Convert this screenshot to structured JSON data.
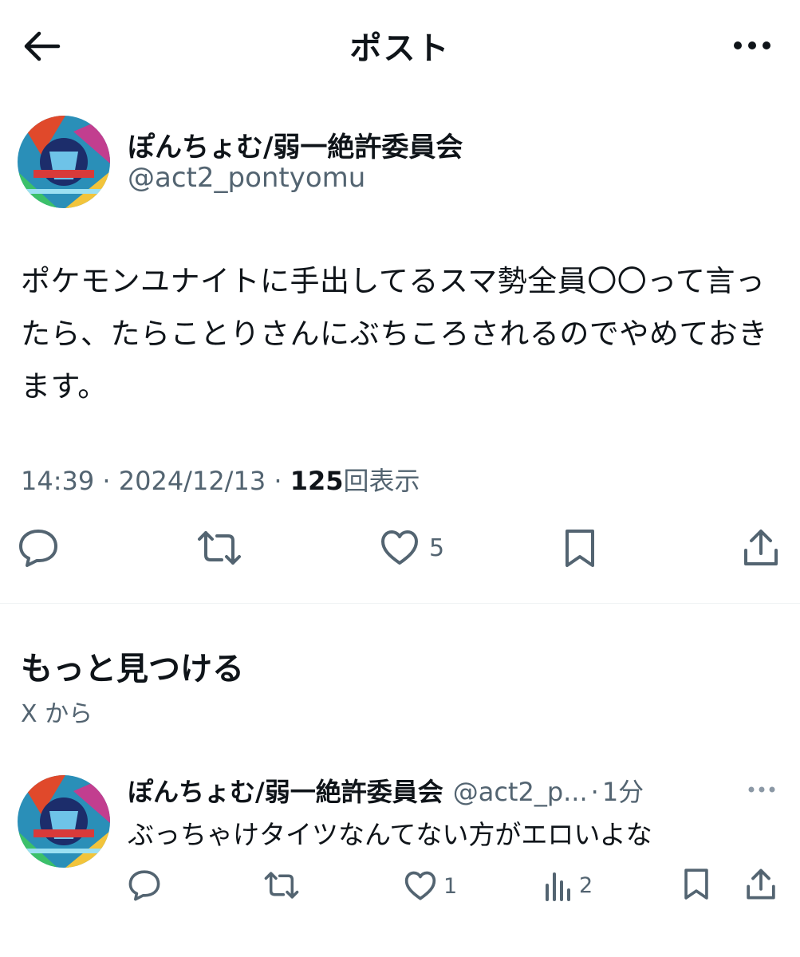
{
  "header": {
    "title": "ポスト",
    "back_icon": "arrow-left-icon",
    "more_icon": "more-horizontal-icon"
  },
  "post": {
    "author_name": "ぽんちょむ/弱一絶許委員会",
    "author_handle": "@act2_pontyomu",
    "text": "ポケモンユナイトに手出してるスマ勢全員〇〇って言ったら、たらことりさんにぶちころされるのでやめておきます。",
    "time": "14:39",
    "date": "2024/12/13",
    "separator": "·",
    "views_count": "125",
    "views_label": "回表示",
    "actions": {
      "reply_icon": "reply-icon",
      "repost_icon": "repost-icon",
      "like_icon": "heart-icon",
      "like_count": "5",
      "bookmark_icon": "bookmark-icon",
      "share_icon": "share-icon"
    }
  },
  "discover": {
    "title": "もっと見つける",
    "subtitle": "X から"
  },
  "reply_post": {
    "author_name": "ぽんちょむ/弱一絶許委員会",
    "author_handle": "@act2_p...",
    "separator": "·",
    "time": "1分",
    "text": "ぶっちゃけタイツなんてない方がエロいよな",
    "like_count": "1",
    "views_count": "2"
  },
  "colors": {
    "text_primary": "#0f1419",
    "text_secondary": "#536471",
    "divider": "#eff3f4",
    "background": "#ffffff"
  }
}
